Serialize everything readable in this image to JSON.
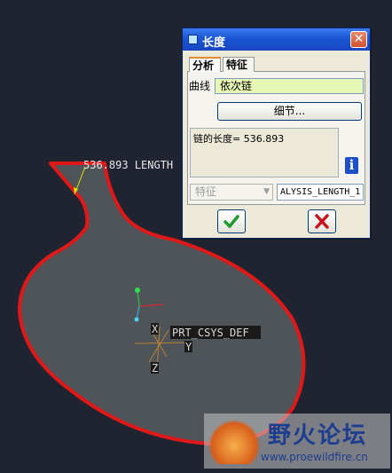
{
  "viewport": {
    "length_annotation": "536.893 LENGTH",
    "csys_label": "PRT_CSYS_DEF",
    "axis_x_label": "X",
    "axis_y_label": "Y",
    "axis_z_label": "Z",
    "colors": {
      "background": "#1f2430",
      "outline": "#e01818",
      "surface": "#4f5459",
      "dimension": "#e8e000"
    }
  },
  "dialog": {
    "title": "长度",
    "close_label": "✕",
    "tabs": [
      {
        "label": "分析",
        "selected": true
      },
      {
        "label": "特征",
        "selected": false
      }
    ],
    "curve_label": "曲线",
    "curve_value": "依次链",
    "details_label": "细节...",
    "result_text": "链的长度= 536.893",
    "info_icon": "i",
    "feature_select_value": "特征",
    "feature_name_value": "ALYSIS_LENGTH_1",
    "ok_icon": "checkmark-icon",
    "cancel_icon": "x-icon"
  },
  "watermark": {
    "title": "野火论坛",
    "url": "www.proewildfire.cn"
  }
}
